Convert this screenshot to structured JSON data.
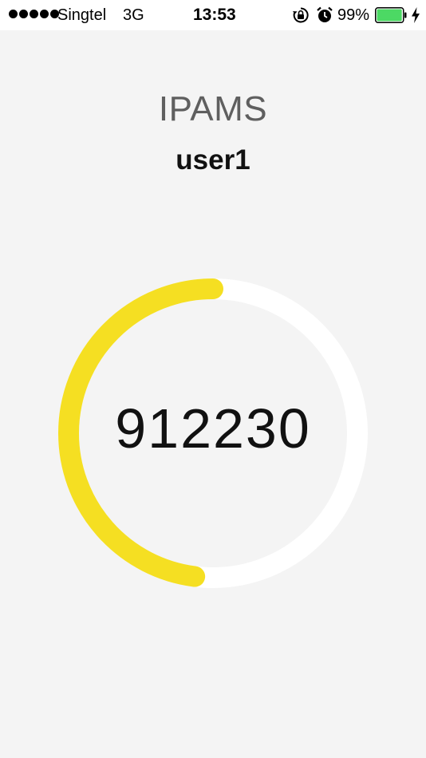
{
  "status_bar": {
    "carrier": "Singtel",
    "network": "3G",
    "time": "13:53",
    "battery_percent": "99%",
    "battery_color": "#4cd964",
    "signal_bars": 5,
    "icons": [
      "rotation-lock-icon",
      "alarm-icon",
      "battery-icon",
      "charging-icon"
    ]
  },
  "app": {
    "title": "IPAMS",
    "username": "user1"
  },
  "otp": {
    "code": "912230",
    "countdown_fraction_remaining": 0.48,
    "progress_color": "#f5df22",
    "track_color": "#ffffff"
  }
}
